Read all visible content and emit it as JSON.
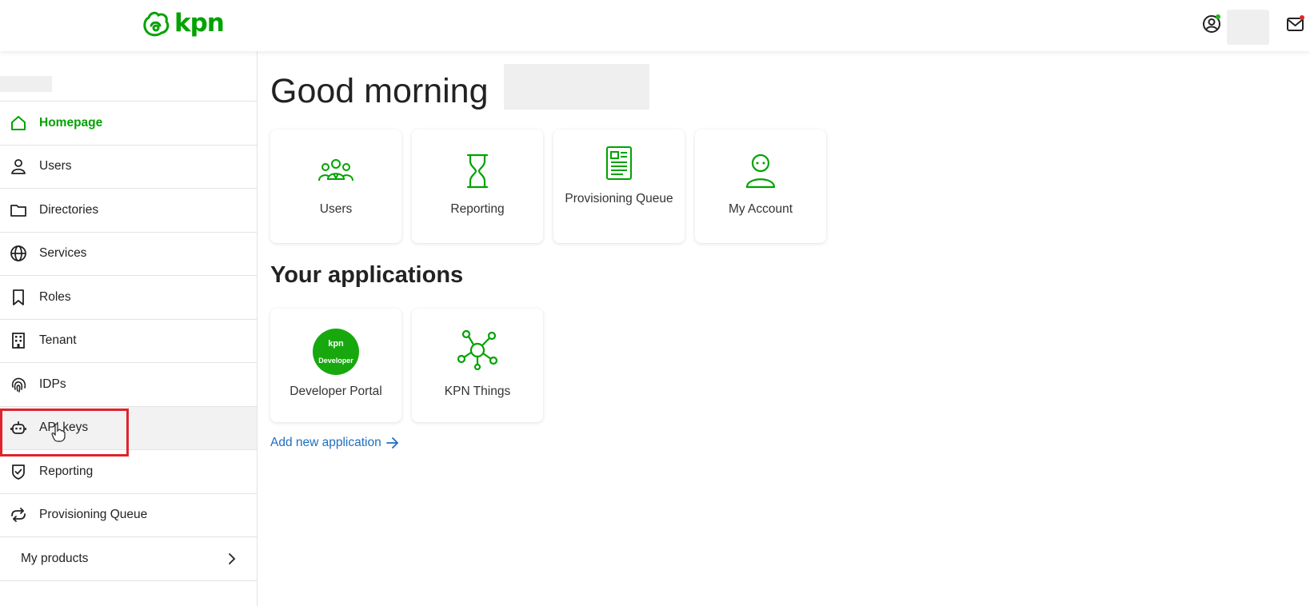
{
  "header": {
    "logo_text": "kpn",
    "brand_color": "#00a300"
  },
  "sidebar": {
    "items": [
      {
        "label": "Homepage",
        "icon": "home-icon"
      },
      {
        "label": "Users",
        "icon": "user-icon"
      },
      {
        "label": "Directories",
        "icon": "folder-icon"
      },
      {
        "label": "Services",
        "icon": "globe-icon"
      },
      {
        "label": "Roles",
        "icon": "bookmark-icon"
      },
      {
        "label": "Tenant",
        "icon": "building-icon"
      },
      {
        "label": "IDPs",
        "icon": "fingerprint-icon"
      },
      {
        "label": "API keys",
        "icon": "robot-icon"
      },
      {
        "label": "Reporting",
        "icon": "shield-check-icon"
      },
      {
        "label": "Provisioning Queue",
        "icon": "sync-icon"
      },
      {
        "label": "My products",
        "icon": "chevron-right-icon"
      }
    ]
  },
  "main": {
    "greeting": "Good morning",
    "quick_links": [
      {
        "label": "Users",
        "icon": "users-group-icon"
      },
      {
        "label": "Reporting",
        "icon": "hourglass-icon"
      },
      {
        "label": "Provisioning Queue",
        "icon": "document-icon"
      },
      {
        "label": "My Account",
        "icon": "account-icon"
      }
    ],
    "applications_title": "Your applications",
    "applications": [
      {
        "label": "Developer Portal",
        "badge_top": "kpn",
        "badge_bottom": "Developer"
      },
      {
        "label": "KPN Things",
        "icon": "network-nodes-icon"
      }
    ],
    "add_application": "Add new application"
  }
}
